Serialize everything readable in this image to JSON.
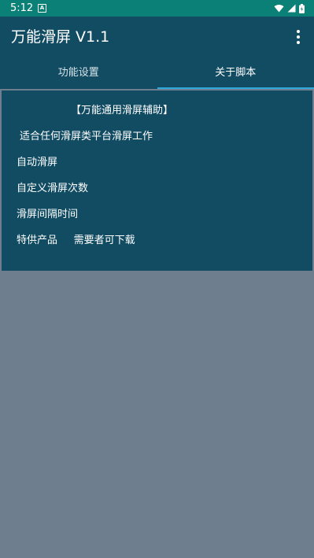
{
  "status_bar": {
    "time": "5:12",
    "left_icon": "a-icon",
    "right_icons": [
      "wifi-icon",
      "signal-icon",
      "battery-icon"
    ]
  },
  "app_bar": {
    "title": "万能滑屏 V1.1",
    "menu_icon": "more-vert-icon"
  },
  "tabs": [
    {
      "label": "功能设置",
      "selected": false
    },
    {
      "label": "关于脚本",
      "selected": true
    }
  ],
  "about": {
    "lines": [
      "【万能通用滑屏辅助】",
      "适合任何滑屏类平台滑屏工作",
      "自动滑屏",
      "自定义滑屏次数",
      "滑屏间隔时间",
      "特供产品     需要者可下载"
    ]
  },
  "colors": {
    "status_bar": "#0b8077",
    "primary": "#124c63",
    "background": "#6f7e8e",
    "tab_indicator": "#2fa7df",
    "text": "#ffffff"
  }
}
